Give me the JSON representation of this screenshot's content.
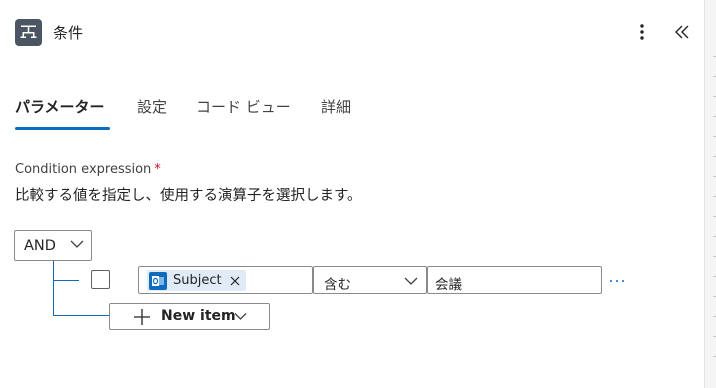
{
  "header": {
    "title": "条件",
    "icon": "condition-icon",
    "more_icon": "more-vertical-icon",
    "collapse_icon": "chevron-double-left-icon"
  },
  "tabs": [
    {
      "label": "パラメーター",
      "active": true
    },
    {
      "label": "設定",
      "active": false
    },
    {
      "label": "コード ビュー",
      "active": false
    },
    {
      "label": "詳細",
      "active": false
    }
  ],
  "condition": {
    "label": "Condition expression",
    "required_mark": "*",
    "description": "比較する値を指定し、使用する演算子を選択します。",
    "group_operator": "AND",
    "rows": [
      {
        "checked": false,
        "left_token": {
          "label": "Subject",
          "icon": "outlook-icon"
        },
        "operator": "含む",
        "right_value": "会議",
        "more": "…"
      }
    ],
    "new_item_label": "New item"
  },
  "colors": {
    "accent": "#0f6cbd",
    "token_bg": "#e0ebf7",
    "required": "#c50f1f"
  }
}
